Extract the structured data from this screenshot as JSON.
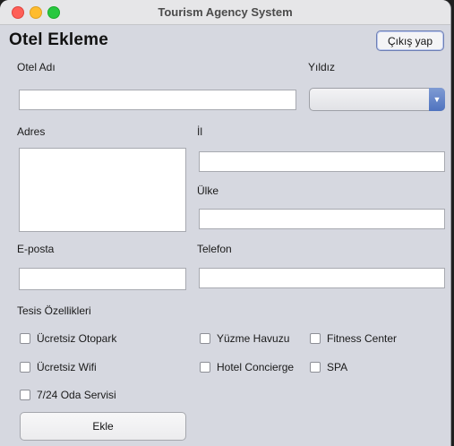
{
  "window": {
    "title": "Tourism Agency System"
  },
  "header": {
    "title": "Otel Ekleme",
    "exit_label": "Çıkış yap"
  },
  "form": {
    "name_label": "Otel Adı",
    "stars_label": "Yıldız",
    "stars_value": "",
    "address_label": "Adres",
    "city_label": "İl",
    "country_label": "Ülke",
    "email_label": "E-posta",
    "phone_label": "Telefon",
    "features_label": "Tesis Özellikleri"
  },
  "features": [
    {
      "label": "Ücretsiz Otopark",
      "checked": false
    },
    {
      "label": "Yüzme Havuzu",
      "checked": false
    },
    {
      "label": "Fitness Center",
      "checked": false
    },
    {
      "label": "Ücretsiz Wifi",
      "checked": false
    },
    {
      "label": "Hotel Concierge",
      "checked": false
    },
    {
      "label": "SPA",
      "checked": false
    },
    {
      "label": "7/24 Oda Servisi",
      "checked": false
    }
  ],
  "actions": {
    "add_label": "Ekle"
  }
}
